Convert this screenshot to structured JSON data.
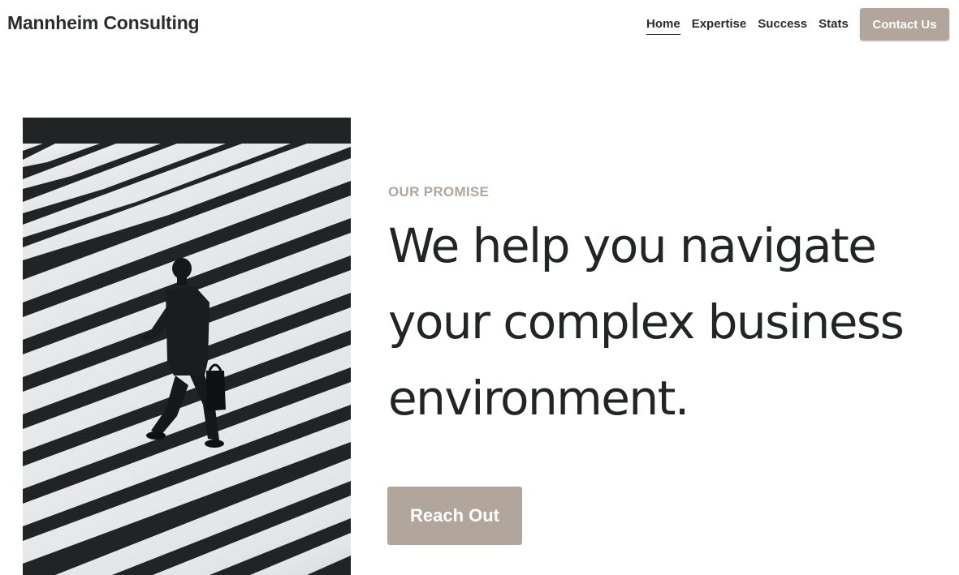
{
  "header": {
    "brand": "Mannheim Consulting",
    "nav": [
      "Home",
      "Expertise",
      "Success",
      "Stats"
    ],
    "active_nav": "Home",
    "contact_label": "Contact Us"
  },
  "hero": {
    "eyebrow": "OUR PROMISE",
    "headline": "We help you navigate your complex business environment.",
    "cta_label": "Reach Out",
    "image_subject": "businessman-crossing-crosswalk"
  },
  "colors": {
    "accent": "#b1a59c",
    "text": "#222426",
    "background": "#ffffff"
  }
}
